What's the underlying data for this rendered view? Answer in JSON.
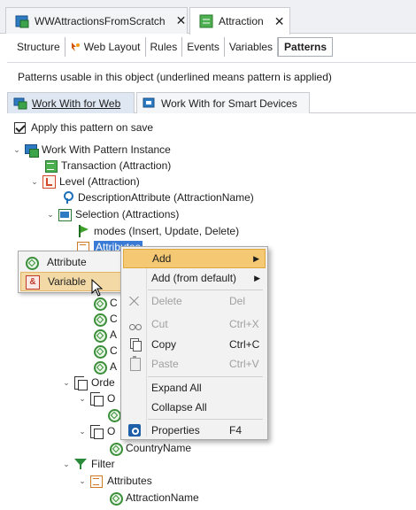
{
  "doc_tabs": [
    {
      "label": "WWAttractionsFromScratch",
      "icon": "grid-icon",
      "active": false
    },
    {
      "label": "Attraction",
      "icon": "transaction-icon",
      "active": true
    }
  ],
  "close_glyph": "✕",
  "object_tabs": [
    "Structure",
    "Web Layout",
    "Rules",
    "Events",
    "Variables",
    "Patterns"
  ],
  "info_text": "Patterns usable in this object (underlined means pattern is applied)",
  "pattern_tabs": [
    {
      "label": "Work With for Web",
      "active": true
    },
    {
      "label": "Work With for Smart Devices",
      "active": false
    }
  ],
  "apply_label": "Apply this pattern on save",
  "tree": {
    "root": "Work With Pattern Instance",
    "transaction": "Transaction (Attraction)",
    "level": "Level (Attraction)",
    "description_attr": "DescriptionAttribute (AttractionName)",
    "selection": "Selection (Attractions)",
    "modes": "modes (Insert, Update, Delete)",
    "attributes_partial": "Attributes",
    "truncated_items": [
      "C",
      "C",
      "A",
      "C",
      "A"
    ],
    "orders_partial": "Orde",
    "order_child_1": "O",
    "order_child_2": "O",
    "country_name": "CountryName",
    "filter": "Filter",
    "filter_attributes": "Attributes",
    "attraction_name": "AttractionName"
  },
  "left_popup": [
    {
      "label": "Attribute",
      "icon": "attribute-icon",
      "highlighted": false
    },
    {
      "label": "Variable",
      "icon": "variable-icon",
      "highlighted": true
    }
  ],
  "context_menu": [
    {
      "label": "Add",
      "shortcut": "",
      "submenu": true,
      "enabled": true,
      "highlighted": true,
      "icon": ""
    },
    {
      "label": "Add (from default)",
      "shortcut": "",
      "submenu": true,
      "enabled": true,
      "highlighted": false,
      "icon": ""
    },
    {
      "label": "Delete",
      "shortcut": "Del",
      "submenu": false,
      "enabled": false,
      "highlighted": false,
      "icon": "delete-icon"
    },
    {
      "label": "Cut",
      "shortcut": "Ctrl+X",
      "submenu": false,
      "enabled": false,
      "highlighted": false,
      "icon": "cut-icon"
    },
    {
      "label": "Copy",
      "shortcut": "Ctrl+C",
      "submenu": false,
      "enabled": true,
      "highlighted": false,
      "icon": "copy-icon"
    },
    {
      "label": "Paste",
      "shortcut": "Ctrl+V",
      "submenu": false,
      "enabled": false,
      "highlighted": false,
      "icon": "paste-icon"
    },
    {
      "label": "Expand All",
      "shortcut": "",
      "submenu": false,
      "enabled": true,
      "highlighted": false,
      "icon": ""
    },
    {
      "label": "Collapse All",
      "shortcut": "",
      "submenu": false,
      "enabled": true,
      "highlighted": false,
      "icon": ""
    },
    {
      "label": "Properties",
      "shortcut": "F4",
      "submenu": false,
      "enabled": true,
      "highlighted": false,
      "icon": "properties-icon"
    }
  ],
  "submenu_arrow": "▶",
  "chevron_open": "⌄",
  "colors": {
    "menu_highlight": "#f5c873",
    "popup_highlight": "#f3d9a6",
    "pattern_tab_active": "#dfe7f3",
    "disabled_text": "#a0a0a0"
  }
}
